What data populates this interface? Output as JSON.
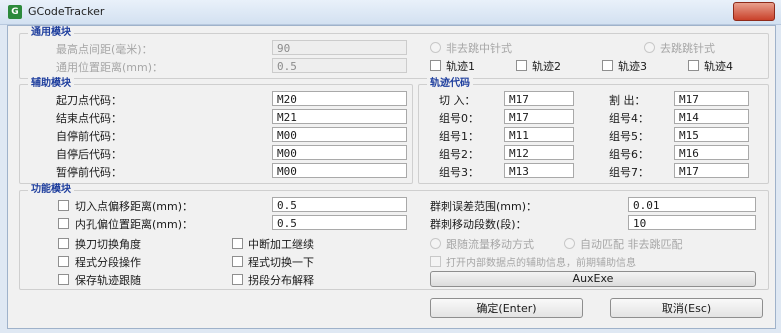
{
  "window": {
    "title": "GCodeTracker",
    "icon": "app-icon"
  },
  "group1": {
    "legend": "通用模块",
    "fields": [
      {
        "label": "最高点间距(毫米)：",
        "value": "90"
      },
      {
        "label": "通用位置距离(mm)：",
        "value": "0.5"
      }
    ],
    "radios": [
      {
        "label": "非去跳中针式"
      },
      {
        "label": "去跳跳针式"
      }
    ],
    "checks": [
      {
        "label": "轨迹1"
      },
      {
        "label": "轨迹2"
      },
      {
        "label": "轨迹3"
      },
      {
        "label": "轨迹4"
      }
    ]
  },
  "group2": {
    "legend": "辅助模块",
    "rows": [
      {
        "label": "起刀点代码：",
        "value": "M20"
      },
      {
        "label": "结束点代码：",
        "value": "M21"
      },
      {
        "label": "自停前代码：",
        "value": "M00"
      },
      {
        "label": "自停后代码：",
        "value": "M00"
      },
      {
        "label": "暂停前代码：",
        "value": "M00"
      }
    ]
  },
  "group3": {
    "legend": "轨迹代码",
    "left": [
      {
        "label": "切 入：",
        "value": "M17"
      },
      {
        "label": "组号0：",
        "value": "M17"
      },
      {
        "label": "组号1：",
        "value": "M11"
      },
      {
        "label": "组号2：",
        "value": "M12"
      },
      {
        "label": "组号3：",
        "value": "M13"
      }
    ],
    "right": [
      {
        "label": "割 出：",
        "value": "M17"
      },
      {
        "label": "组号4：",
        "value": "M14"
      },
      {
        "label": "组号5：",
        "value": "M15"
      },
      {
        "label": "组号6：",
        "value": "M16"
      },
      {
        "label": "组号7：",
        "value": "M17"
      }
    ]
  },
  "group4": {
    "legend": "功能模块",
    "checkfields": [
      {
        "label": "切入点偏移距离(mm)：",
        "value": "0.5"
      },
      {
        "label": "内孔偏位置距离(mm)：",
        "value": "0.5"
      }
    ],
    "rightfields": [
      {
        "label": "群刺误差范围(mm)：",
        "value": "0.01"
      },
      {
        "label": "群刺移动段数(段)：",
        "value": "10"
      }
    ],
    "checks_a": [
      {
        "label": "换刀切换角度"
      },
      {
        "label": "程式分段操作"
      },
      {
        "label": "保存轨迹跟随"
      }
    ],
    "checks_b": [
      {
        "label": "中断加工继续"
      },
      {
        "label": "程式切换一下"
      },
      {
        "label": "拐段分布解释"
      }
    ],
    "disabled_radio": "跟随流量移动方式",
    "disabled_radio2": "自动匹配 非去跳匹配",
    "disabled_check": "打开内部数据点的辅助信息，前期辅助信息",
    "aux_button": "AuxExe"
  },
  "footer": {
    "ok": "确定(Enter)",
    "cancel": "取消(Esc)"
  }
}
